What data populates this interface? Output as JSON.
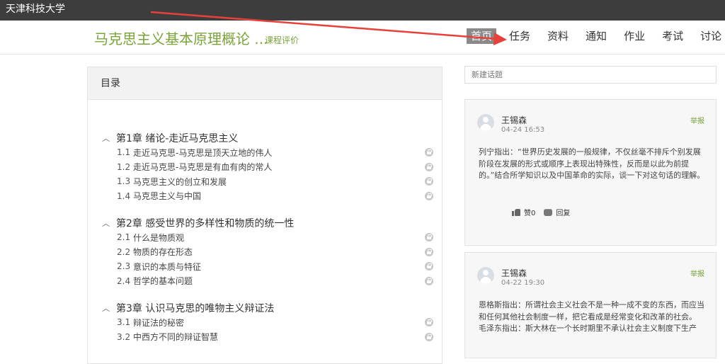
{
  "topbar": {
    "school_name": "天津科技大学"
  },
  "header": {
    "course_title": "马克思主义基本原理概论 ...",
    "course_eval": "课程评价",
    "nav": [
      {
        "label": "首页",
        "active": true
      },
      {
        "label": "任务"
      },
      {
        "label": "资料"
      },
      {
        "label": "通知"
      },
      {
        "label": "作业"
      },
      {
        "label": "考试"
      },
      {
        "label": "讨论"
      }
    ]
  },
  "annotation": {
    "arrow_color": "#e8403a"
  },
  "toc": {
    "title": "目录",
    "chapters": [
      {
        "title": "第1章 绪论-走近马克思主义",
        "lessons": [
          {
            "num": "1.1",
            "title": "走近马克思-马克思是顶天立地的伟人"
          },
          {
            "num": "1.2",
            "title": "走近马克思-马克思是有血有肉的常人"
          },
          {
            "num": "1.3",
            "title": "马克思主义的创立和发展"
          },
          {
            "num": "1.4",
            "title": "马克思主义与中国"
          }
        ]
      },
      {
        "title": "第2章 感受世界的多样性和物质的统一性",
        "lessons": [
          {
            "num": "2.1",
            "title": "什么是物质观"
          },
          {
            "num": "2.2",
            "title": "物质的存在形态"
          },
          {
            "num": "2.3",
            "title": "意识的本质与特征"
          },
          {
            "num": "2.4",
            "title": "哲学的基本问题"
          }
        ]
      },
      {
        "title": "第3章 认识马克思的唯物主义辩证法",
        "lessons": [
          {
            "num": "3.1",
            "title": "辩证法的秘密"
          },
          {
            "num": "3.2",
            "title": "中西方不同的辩证智慧"
          }
        ]
      }
    ]
  },
  "discussion": {
    "new_topic_placeholder": "新建话题",
    "posts": [
      {
        "author": "王锡森",
        "time": "04-24 16:53",
        "report": "举报",
        "body": "列宁指出：“世界历史发展的一般规律，不仅丝毫不排斥个别发展阶段在发展的形式或顺序上表现出特殊性，反而是以此为前提的。”结合所学知识以及中国革命的实际，谈一下对这句话的理解。",
        "like": "赞0",
        "reply": "回复"
      },
      {
        "author": "王锡森",
        "time": "04-22 19:30",
        "report": "举报",
        "body": "恩格斯指出：所谓社会主义社会不是一种一成不变的东西，而应当和任何其他社会制度一样，把它看成是经常变化和改革的社会。\n毛泽东指出：斯大林在一个长时期里不承认社会主义制度下生产"
      }
    ]
  }
}
